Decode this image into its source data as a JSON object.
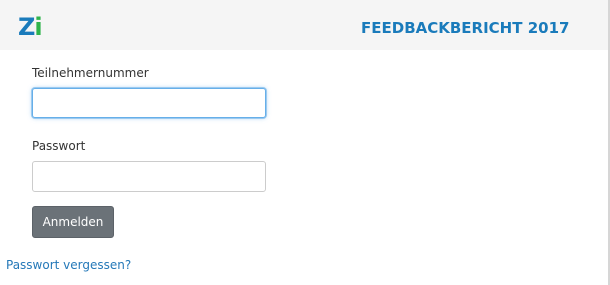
{
  "header": {
    "logo_text": "Zi",
    "report_title": "FEEDBACKBERICHT 2017"
  },
  "login_form": {
    "participant_number_label": "Teilnehmernummer",
    "participant_number_value": "",
    "password_label": "Passwort",
    "password_value": "",
    "submit_label": "Anmelden",
    "forgot_password_label": "Passwort vergessen?"
  },
  "colors": {
    "brand_blue": "#1a7bbb",
    "brand_green": "#2fb44b",
    "header_background": "#f5f5f5",
    "button_background": "#6b7278",
    "link": "#2478b8",
    "focus_border": "#66afe9"
  }
}
